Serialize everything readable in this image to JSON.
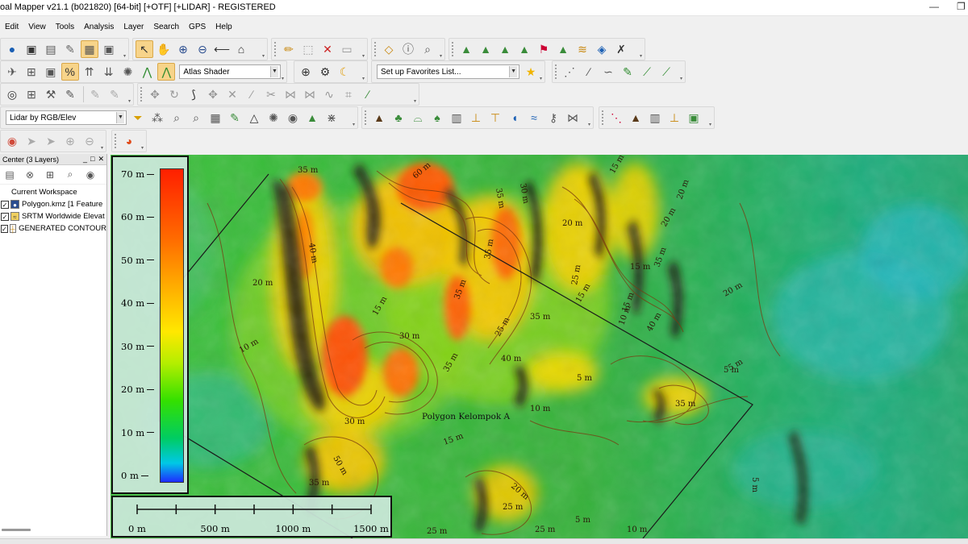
{
  "window": {
    "title": "oal Mapper v21.1 (b021820) [64-bit] [+OTF] [+LIDAR] - REGISTERED",
    "minimize_glyph": "—",
    "restore_glyph": "❐"
  },
  "menu": [
    "Edit",
    "View",
    "Tools",
    "Analysis",
    "Layer",
    "Search",
    "GPS",
    "Help"
  ],
  "toolbars": {
    "shader_select": "Atlas Shader",
    "favorites_select": "Set up Favorites List...",
    "lidar_select": "Lidar by RGB/Elev"
  },
  "control_center": {
    "title": "Center (3 Layers)",
    "header_buttons": [
      "_",
      "□",
      "✕"
    ],
    "workspace_label": "Current Workspace",
    "layers": [
      {
        "name": "Polygon.kmz [1 Feature",
        "checked": true,
        "icon": "kmz-layer-icon"
      },
      {
        "name": "SRTM Worldwide Elevat",
        "checked": true,
        "icon": "elevation-layer-icon"
      },
      {
        "name": "GENERATED CONTOUR",
        "checked": true,
        "icon": "contour-layer-icon"
      }
    ]
  },
  "map": {
    "polygon_label": "Polygon Kelompok A",
    "contour_labels": [
      "35 m",
      "60 m",
      "30 m",
      "35 m",
      "15 m",
      "20 m",
      "20 m",
      "40 m",
      "35 m",
      "25 m",
      "35 m",
      "15 m",
      "20 m",
      "15 m",
      "10 m",
      "30 m",
      "35 m",
      "25 m",
      "35 m",
      "15 m",
      "20 m",
      "35 m",
      "40 m",
      "40 m",
      "15 m",
      "5 m",
      "10 m",
      "5 m",
      "20 m",
      "15 m",
      "35 m",
      "10 m",
      "30 m",
      "50 m",
      "35 m",
      "25 m",
      "25 m",
      "5 m",
      "5 m",
      "5 m",
      "10 m",
      "25 m",
      "20 m"
    ]
  },
  "legend": {
    "ticks": [
      "70 m",
      "60 m",
      "50 m",
      "40 m",
      "30 m",
      "20 m",
      "10 m",
      "0 m"
    ],
    "colors": {
      "top": "#ff1f00",
      "mid": "#ffe800",
      "low": "#00cc62",
      "bottom": "#1e2cff"
    }
  },
  "scale_bar": {
    "labels": [
      "0 m",
      "500 m",
      "1000 m",
      "1500 m"
    ]
  }
}
